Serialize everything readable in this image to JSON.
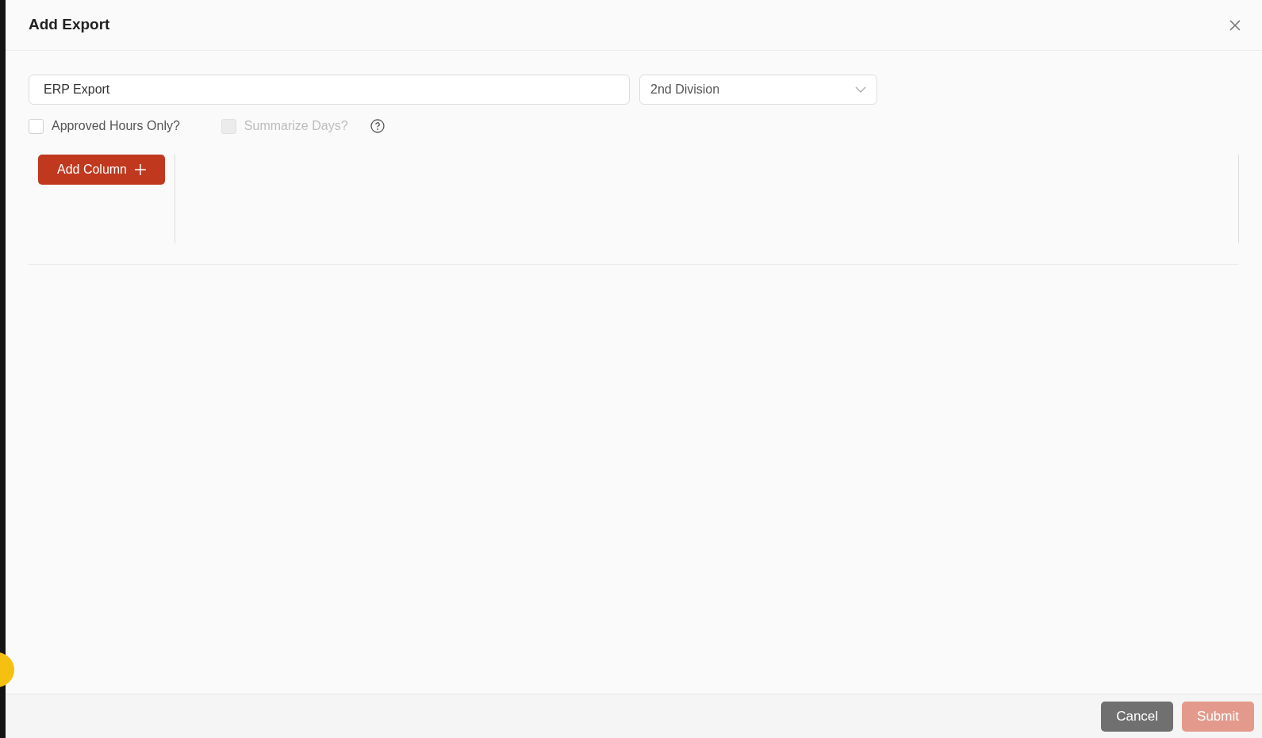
{
  "dialog": {
    "title": "Add Export"
  },
  "name_field": {
    "value": "ERP Export"
  },
  "division_select": {
    "value": "2nd Division"
  },
  "options": [
    {
      "label": "Approved Hours Only?",
      "checked": false,
      "disabled": false,
      "help": false
    },
    {
      "label": "Summarize Days?",
      "checked": false,
      "disabled": true,
      "help": true
    }
  ],
  "add_column_button": {
    "label": "Add Column"
  },
  "footer_buttons": [
    {
      "label": "Cancel",
      "kind": "secondary",
      "disabled": false
    },
    {
      "label": "Submit",
      "kind": "primary",
      "disabled": true
    }
  ]
}
